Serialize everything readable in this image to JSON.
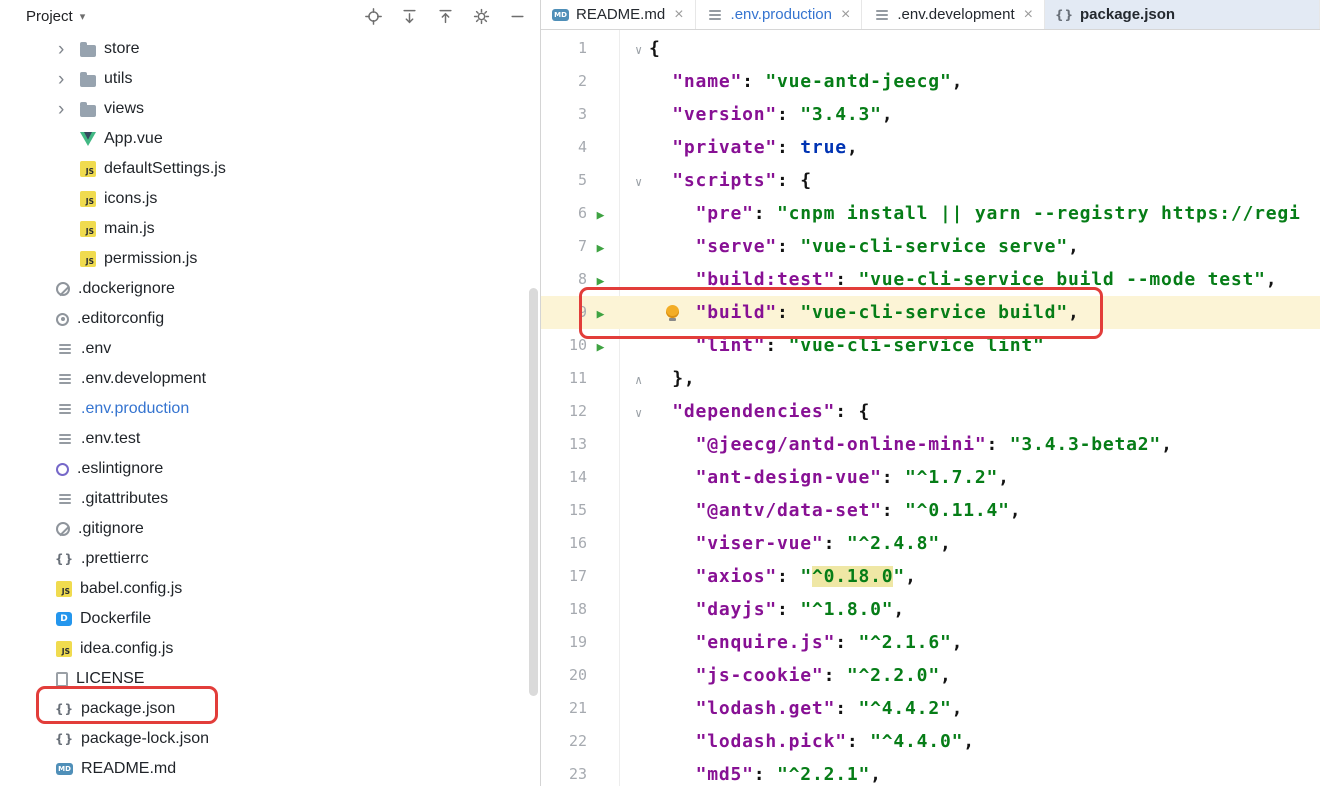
{
  "project_panel": {
    "title": "Project",
    "toolbar_icons": [
      {
        "name": "locate-file-icon"
      },
      {
        "name": "expand-all-icon"
      },
      {
        "name": "collapse-all-icon"
      },
      {
        "name": "settings-gear-icon"
      },
      {
        "name": "hide-panel-icon"
      }
    ],
    "tree": [
      {
        "label": "store",
        "icon": "folder",
        "chevron": true,
        "level": 2
      },
      {
        "label": "utils",
        "icon": "folder",
        "chevron": true,
        "level": 2
      },
      {
        "label": "views",
        "icon": "folder",
        "chevron": true,
        "level": 2
      },
      {
        "label": "App.vue",
        "icon": "vue",
        "level": 2
      },
      {
        "label": "defaultSettings.js",
        "icon": "js",
        "level": 2
      },
      {
        "label": "icons.js",
        "icon": "js",
        "level": 2
      },
      {
        "label": "main.js",
        "icon": "js",
        "level": 2
      },
      {
        "label": "permission.js",
        "icon": "js",
        "level": 2
      },
      {
        "label": ".dockerignore",
        "icon": "ignore",
        "level": 1
      },
      {
        "label": ".editorconfig",
        "icon": "config",
        "level": 1
      },
      {
        "label": ".env",
        "icon": "env",
        "level": 1
      },
      {
        "label": ".env.development",
        "icon": "env",
        "level": 1
      },
      {
        "label": ".env.production",
        "icon": "env",
        "level": 1,
        "modified": true
      },
      {
        "label": ".env.test",
        "icon": "env",
        "level": 1
      },
      {
        "label": ".eslintignore",
        "icon": "eslint",
        "level": 1
      },
      {
        "label": ".gitattributes",
        "icon": "env",
        "level": 1
      },
      {
        "label": ".gitignore",
        "icon": "ignore",
        "level": 1
      },
      {
        "label": ".prettierrc",
        "icon": "braces",
        "level": 1
      },
      {
        "label": "babel.config.js",
        "icon": "js",
        "level": 1
      },
      {
        "label": "Dockerfile",
        "icon": "docker",
        "level": 1
      },
      {
        "label": "idea.config.js",
        "icon": "js",
        "level": 1
      },
      {
        "label": "LICENSE",
        "icon": "text",
        "level": 1
      },
      {
        "label": "package.json",
        "icon": "braces",
        "level": 1,
        "annotated": true
      },
      {
        "label": "package-lock.json",
        "icon": "braces",
        "level": 1
      },
      {
        "label": "README.md",
        "icon": "md",
        "level": 1
      }
    ]
  },
  "tabs": [
    {
      "label": "README.md",
      "icon": "md"
    },
    {
      "label": ".env.production",
      "icon": "env",
      "modified": true
    },
    {
      "label": ".env.development",
      "icon": "env"
    },
    {
      "label": "package.json",
      "icon": "braces",
      "active": true,
      "closable": false
    }
  ],
  "editor": {
    "lines": [
      {
        "n": 1,
        "fold": "open",
        "seg": [
          {
            "t": "{",
            "c": "p"
          }
        ]
      },
      {
        "n": 2,
        "seg": [
          {
            "t": "  ",
            "c": "p"
          },
          {
            "t": "\"name\"",
            "c": "k"
          },
          {
            "t": ": ",
            "c": "p"
          },
          {
            "t": "\"vue-antd-jeecg\"",
            "c": "s"
          },
          {
            "t": ",",
            "c": "p"
          }
        ]
      },
      {
        "n": 3,
        "seg": [
          {
            "t": "  ",
            "c": "p"
          },
          {
            "t": "\"version\"",
            "c": "k"
          },
          {
            "t": ": ",
            "c": "p"
          },
          {
            "t": "\"3.4.3\"",
            "c": "s"
          },
          {
            "t": ",",
            "c": "p"
          }
        ]
      },
      {
        "n": 4,
        "seg": [
          {
            "t": "  ",
            "c": "p"
          },
          {
            "t": "\"private\"",
            "c": "k"
          },
          {
            "t": ": ",
            "c": "p"
          },
          {
            "t": "true",
            "c": "b"
          },
          {
            "t": ",",
            "c": "p"
          }
        ]
      },
      {
        "n": 5,
        "fold": "open",
        "seg": [
          {
            "t": "  ",
            "c": "p"
          },
          {
            "t": "\"scripts\"",
            "c": "k"
          },
          {
            "t": ": {",
            "c": "p"
          }
        ]
      },
      {
        "n": 6,
        "run": true,
        "seg": [
          {
            "t": "    ",
            "c": "p"
          },
          {
            "t": "\"pre\"",
            "c": "k"
          },
          {
            "t": ": ",
            "c": "p"
          },
          {
            "t": "\"cnpm install || yarn --registry https://regi",
            "c": "s"
          }
        ]
      },
      {
        "n": 7,
        "run": true,
        "seg": [
          {
            "t": "    ",
            "c": "p"
          },
          {
            "t": "\"serve\"",
            "c": "k"
          },
          {
            "t": ": ",
            "c": "p"
          },
          {
            "t": "\"vue-cli-service serve\"",
            "c": "s"
          },
          {
            "t": ",",
            "c": "p"
          }
        ]
      },
      {
        "n": 8,
        "run": true,
        "seg": [
          {
            "t": "    ",
            "c": "p"
          },
          {
            "t": "\"build:test\"",
            "c": "k"
          },
          {
            "t": ": ",
            "c": "p"
          },
          {
            "t": "\"vue-cli-service build --mode test\"",
            "c": "s"
          },
          {
            "t": ",",
            "c": "p"
          }
        ]
      },
      {
        "n": 9,
        "run": true,
        "current": true,
        "bulb": true,
        "seg": [
          {
            "t": "    ",
            "c": "p"
          },
          {
            "t": "\"build\"",
            "c": "k"
          },
          {
            "t": ": ",
            "c": "p"
          },
          {
            "t": "\"vue-cli-service build\"",
            "c": "s"
          },
          {
            "t": ",",
            "c": "p"
          }
        ]
      },
      {
        "n": 10,
        "run": true,
        "seg": [
          {
            "t": "    ",
            "c": "p"
          },
          {
            "t": "\"lint\"",
            "c": "k"
          },
          {
            "t": ": ",
            "c": "p"
          },
          {
            "t": "\"vue-cli-service lint\"",
            "c": "s"
          }
        ]
      },
      {
        "n": 11,
        "fold": "end",
        "seg": [
          {
            "t": "  },",
            "c": "p"
          }
        ]
      },
      {
        "n": 12,
        "fold": "open",
        "seg": [
          {
            "t": "  ",
            "c": "p"
          },
          {
            "t": "\"dependencies\"",
            "c": "k"
          },
          {
            "t": ": {",
            "c": "p"
          }
        ]
      },
      {
        "n": 13,
        "seg": [
          {
            "t": "    ",
            "c": "p"
          },
          {
            "t": "\"@jeecg/antd-online-mini\"",
            "c": "k"
          },
          {
            "t": ": ",
            "c": "p"
          },
          {
            "t": "\"3.4.3-beta2\"",
            "c": "s"
          },
          {
            "t": ",",
            "c": "p"
          }
        ]
      },
      {
        "n": 14,
        "seg": [
          {
            "t": "    ",
            "c": "p"
          },
          {
            "t": "\"ant-design-vue\"",
            "c": "k"
          },
          {
            "t": ": ",
            "c": "p"
          },
          {
            "t": "\"^1.7.2\"",
            "c": "s"
          },
          {
            "t": ",",
            "c": "p"
          }
        ]
      },
      {
        "n": 15,
        "seg": [
          {
            "t": "    ",
            "c": "p"
          },
          {
            "t": "\"@antv/data-set\"",
            "c": "k"
          },
          {
            "t": ": ",
            "c": "p"
          },
          {
            "t": "\"^0.11.4\"",
            "c": "s"
          },
          {
            "t": ",",
            "c": "p"
          }
        ]
      },
      {
        "n": 16,
        "seg": [
          {
            "t": "    ",
            "c": "p"
          },
          {
            "t": "\"viser-vue\"",
            "c": "k"
          },
          {
            "t": ": ",
            "c": "p"
          },
          {
            "t": "\"^2.4.8\"",
            "c": "s"
          },
          {
            "t": ",",
            "c": "p"
          }
        ]
      },
      {
        "n": 17,
        "seg": [
          {
            "t": "    ",
            "c": "p"
          },
          {
            "t": "\"axios\"",
            "c": "k"
          },
          {
            "t": ": ",
            "c": "p"
          },
          {
            "t": "\"",
            "c": "s"
          },
          {
            "t": "^0.18.0",
            "c": "h"
          },
          {
            "t": "\"",
            "c": "s"
          },
          {
            "t": ",",
            "c": "p"
          }
        ]
      },
      {
        "n": 18,
        "seg": [
          {
            "t": "    ",
            "c": "p"
          },
          {
            "t": "\"dayjs\"",
            "c": "k"
          },
          {
            "t": ": ",
            "c": "p"
          },
          {
            "t": "\"^1.8.0\"",
            "c": "s"
          },
          {
            "t": ",",
            "c": "p"
          }
        ]
      },
      {
        "n": 19,
        "seg": [
          {
            "t": "    ",
            "c": "p"
          },
          {
            "t": "\"enquire.js\"",
            "c": "k"
          },
          {
            "t": ": ",
            "c": "p"
          },
          {
            "t": "\"^2.1.6\"",
            "c": "s"
          },
          {
            "t": ",",
            "c": "p"
          }
        ]
      },
      {
        "n": 20,
        "seg": [
          {
            "t": "    ",
            "c": "p"
          },
          {
            "t": "\"js-cookie\"",
            "c": "k"
          },
          {
            "t": ": ",
            "c": "p"
          },
          {
            "t": "\"^2.2.0\"",
            "c": "s"
          },
          {
            "t": ",",
            "c": "p"
          }
        ]
      },
      {
        "n": 21,
        "seg": [
          {
            "t": "    ",
            "c": "p"
          },
          {
            "t": "\"lodash.get\"",
            "c": "k"
          },
          {
            "t": ": ",
            "c": "p"
          },
          {
            "t": "\"^4.4.2\"",
            "c": "s"
          },
          {
            "t": ",",
            "c": "p"
          }
        ]
      },
      {
        "n": 22,
        "seg": [
          {
            "t": "    ",
            "c": "p"
          },
          {
            "t": "\"lodash.pick\"",
            "c": "k"
          },
          {
            "t": ": ",
            "c": "p"
          },
          {
            "t": "\"^4.4.0\"",
            "c": "s"
          },
          {
            "t": ",",
            "c": "p"
          }
        ]
      },
      {
        "n": 23,
        "seg": [
          {
            "t": "    ",
            "c": "p"
          },
          {
            "t": "\"md5\"",
            "c": "k"
          },
          {
            "t": ": ",
            "c": "p"
          },
          {
            "t": "\"^2.2.1\"",
            "c": "s"
          },
          {
            "t": ",",
            "c": "p"
          }
        ]
      }
    ]
  },
  "colors": {
    "annotation": "#e23d3a",
    "current_line": "#fcf4d6",
    "json_key": "#871094",
    "json_string": "#067d17",
    "keyword": "#0033b3",
    "modified_file": "#3574d0"
  }
}
